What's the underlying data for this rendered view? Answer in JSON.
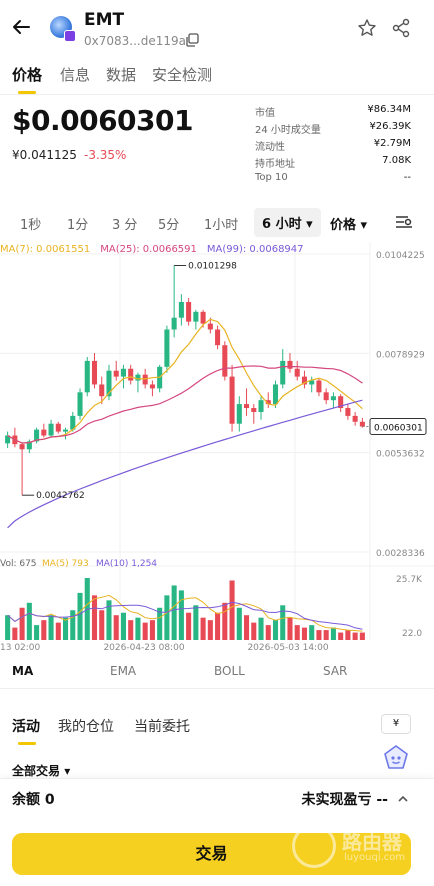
{
  "header": {
    "token_name": "EMT",
    "address": "0x7083...de119a"
  },
  "tabs": [
    "价格",
    "信息",
    "数据",
    "安全检测"
  ],
  "price": {
    "usd": "$0.0060301",
    "cny": "¥0.041125",
    "change": "-3.35%"
  },
  "stats": [
    {
      "label": "市值",
      "value": "¥86.34M"
    },
    {
      "label": "24 小时成交量",
      "value": "¥26.39K"
    },
    {
      "label": "流动性",
      "value": "¥2.79M"
    },
    {
      "label": "持币地址",
      "value": "7.08K"
    },
    {
      "label": "Top 10",
      "value": "--"
    }
  ],
  "timeframes": [
    "1秒",
    "1分",
    "3 分",
    "5分",
    "1小时"
  ],
  "active_timeframe": "6 小时",
  "price_dropdown": "价格",
  "ma_legend": {
    "ma7": "MA(7): 0.0061551",
    "ma25": "MA(25): 0.0066591",
    "ma99": "MA(99): 0.0068947"
  },
  "chart_data": {
    "type": "candlestick",
    "y_ticks": [
      "0.0104225",
      "0.0078929",
      "0.0053632",
      "0.0028336"
    ],
    "ylim": [
      0.0028336,
      0.0104225
    ],
    "high_label": "0.0101298",
    "low_label": "0.0042762",
    "current_label": "0.0060301",
    "x_ticks": [
      "13 02:00",
      "2026-04-23 08:00",
      "2026-05-03 14:00"
    ],
    "candles": [
      [
        0.0056,
        0.0059,
        0.00548,
        0.0058
      ],
      [
        0.0058,
        0.006,
        0.0055,
        0.00558
      ],
      [
        0.00558,
        0.00562,
        0.00428,
        0.00545
      ],
      [
        0.00545,
        0.0057,
        0.00535,
        0.00565
      ],
      [
        0.00565,
        0.006,
        0.0056,
        0.00595
      ],
      [
        0.00595,
        0.0061,
        0.00575,
        0.0058
      ],
      [
        0.0058,
        0.0062,
        0.00575,
        0.0061
      ],
      [
        0.0061,
        0.00615,
        0.00585,
        0.0059
      ],
      [
        0.0059,
        0.006,
        0.0057,
        0.00595
      ],
      [
        0.00595,
        0.0064,
        0.0059,
        0.0063
      ],
      [
        0.0063,
        0.007,
        0.0062,
        0.0069
      ],
      [
        0.0069,
        0.0078,
        0.0068,
        0.0077
      ],
      [
        0.0077,
        0.0079,
        0.007,
        0.0071
      ],
      [
        0.0071,
        0.0073,
        0.0066,
        0.0068
      ],
      [
        0.0068,
        0.0076,
        0.0067,
        0.00745
      ],
      [
        0.00745,
        0.0077,
        0.0072,
        0.0073
      ],
      [
        0.0073,
        0.0076,
        0.007,
        0.0075
      ],
      [
        0.0075,
        0.0076,
        0.0071,
        0.0072
      ],
      [
        0.0072,
        0.0074,
        0.0069,
        0.00735
      ],
      [
        0.00735,
        0.0075,
        0.007,
        0.0071
      ],
      [
        0.0071,
        0.0072,
        0.0068,
        0.007
      ],
      [
        0.007,
        0.0076,
        0.0069,
        0.00755
      ],
      [
        0.00755,
        0.0086,
        0.0074,
        0.0085
      ],
      [
        0.0085,
        0.01013,
        0.0083,
        0.0088
      ],
      [
        0.0088,
        0.0094,
        0.0086,
        0.0092
      ],
      [
        0.0092,
        0.0093,
        0.0086,
        0.0087
      ],
      [
        0.0087,
        0.009,
        0.0085,
        0.00895
      ],
      [
        0.00895,
        0.009,
        0.00855,
        0.00865
      ],
      [
        0.00865,
        0.0088,
        0.0084,
        0.0085
      ],
      [
        0.0085,
        0.0086,
        0.008,
        0.0081
      ],
      [
        0.0081,
        0.0082,
        0.0072,
        0.0073
      ],
      [
        0.0073,
        0.0076,
        0.0059,
        0.0061
      ],
      [
        0.0061,
        0.0068,
        0.0059,
        0.0066
      ],
      [
        0.0066,
        0.007,
        0.0063,
        0.0065
      ],
      [
        0.0065,
        0.0066,
        0.0061,
        0.0064
      ],
      [
        0.0064,
        0.0068,
        0.0062,
        0.0067
      ],
      [
        0.0067,
        0.0069,
        0.0065,
        0.0066
      ],
      [
        0.0066,
        0.0072,
        0.0065,
        0.0071
      ],
      [
        0.0071,
        0.008,
        0.007,
        0.0077
      ],
      [
        0.0077,
        0.0079,
        0.0074,
        0.0075
      ],
      [
        0.0075,
        0.0077,
        0.0072,
        0.0073
      ],
      [
        0.0073,
        0.00745,
        0.007,
        0.0071
      ],
      [
        0.0071,
        0.0073,
        0.0069,
        0.0072
      ],
      [
        0.0072,
        0.00725,
        0.0068,
        0.0069
      ],
      [
        0.0069,
        0.007,
        0.0066,
        0.0067
      ],
      [
        0.0067,
        0.0069,
        0.0065,
        0.0068
      ],
      [
        0.0068,
        0.00685,
        0.0064,
        0.0065
      ],
      [
        0.0065,
        0.0066,
        0.0062,
        0.0063
      ],
      [
        0.0063,
        0.0064,
        0.00605,
        0.00615
      ],
      [
        0.00615,
        0.00625,
        0.006,
        0.00603
      ]
    ],
    "volume": {
      "label": "Vol: 675",
      "ma5": "MA(5) 793",
      "ma10": "MA(10) 1,254",
      "y_ticks": [
        "25.7K",
        "22.0"
      ],
      "values": [
        1.0,
        0.5,
        1.3,
        1.5,
        0.6,
        0.8,
        1.0,
        0.7,
        0.9,
        1.2,
        1.9,
        2.5,
        1.8,
        1.2,
        1.6,
        1.0,
        1.1,
        0.8,
        0.9,
        0.7,
        0.8,
        1.3,
        1.8,
        2.2,
        2.0,
        1.1,
        1.4,
        0.9,
        0.8,
        1.1,
        1.5,
        2.4,
        1.3,
        1.0,
        0.7,
        0.9,
        0.6,
        0.8,
        1.4,
        0.9,
        0.6,
        0.5,
        0.6,
        0.4,
        0.4,
        0.5,
        0.3,
        0.4,
        0.3,
        0.3
      ]
    }
  },
  "indicators": [
    "MA",
    "EMA",
    "BOLL",
    "SAR"
  ],
  "section_tabs": [
    "活动",
    "我的仓位",
    "当前委托"
  ],
  "currency_chip": "¥",
  "filter_label": "全部交易",
  "balance": "余额 0",
  "pnl": "未实现盈亏 --",
  "trade_button": "交易",
  "watermark": {
    "title": "路由器",
    "url": "luyouqi.com"
  },
  "colors": {
    "up": "#28b784",
    "down": "#e84a55",
    "ma7": "#e9b422",
    "ma25": "#d4467f",
    "ma99": "#7a5ad8",
    "accent": "#f6d020"
  }
}
